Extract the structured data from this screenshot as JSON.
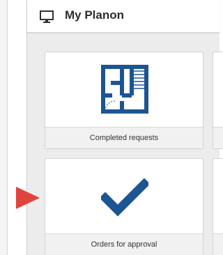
{
  "header": {
    "title": "My Planon",
    "icon": "monitor-icon"
  },
  "tiles": [
    {
      "label": "Completed requests",
      "icon": "floor-plan-icon"
    },
    {
      "label": "Orders for approval",
      "icon": "checkmark-icon"
    }
  ],
  "colors": {
    "icon_blue": "#1d5592",
    "pointer_red": "#e0433b",
    "panel_bg": "#ececec"
  }
}
